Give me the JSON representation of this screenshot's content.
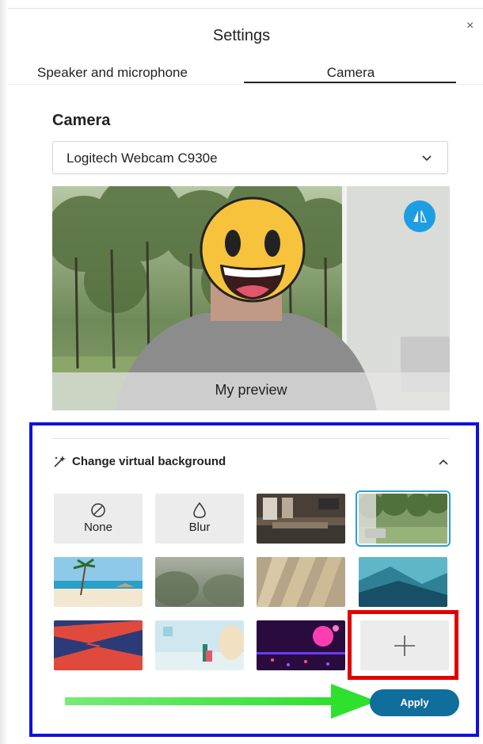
{
  "dialog": {
    "title": "Settings",
    "close_glyph": "×"
  },
  "tabs": [
    {
      "label": "Speaker and microphone",
      "active": false
    },
    {
      "label": "Camera",
      "active": true
    }
  ],
  "camera": {
    "heading": "Camera",
    "device_selected": "Logitech Webcam C930e",
    "preview_label": "My preview",
    "mirror_icon": "mirror-icon"
  },
  "virtual_background": {
    "heading": "Change virtual background",
    "expanded": true,
    "options": [
      {
        "label": "None",
        "icon": "none-icon"
      },
      {
        "label": "Blur",
        "icon": "blur-icon"
      }
    ],
    "selected_index": 3,
    "add_icon": "plus-icon"
  },
  "actions": {
    "apply_label": "Apply"
  },
  "colors": {
    "accent": "#1d9ee3",
    "apply_button": "#0f6e9b",
    "highlight_blue": "#1010e0",
    "highlight_red": "#e00000",
    "annotation_arrow": "#2fe02f"
  }
}
